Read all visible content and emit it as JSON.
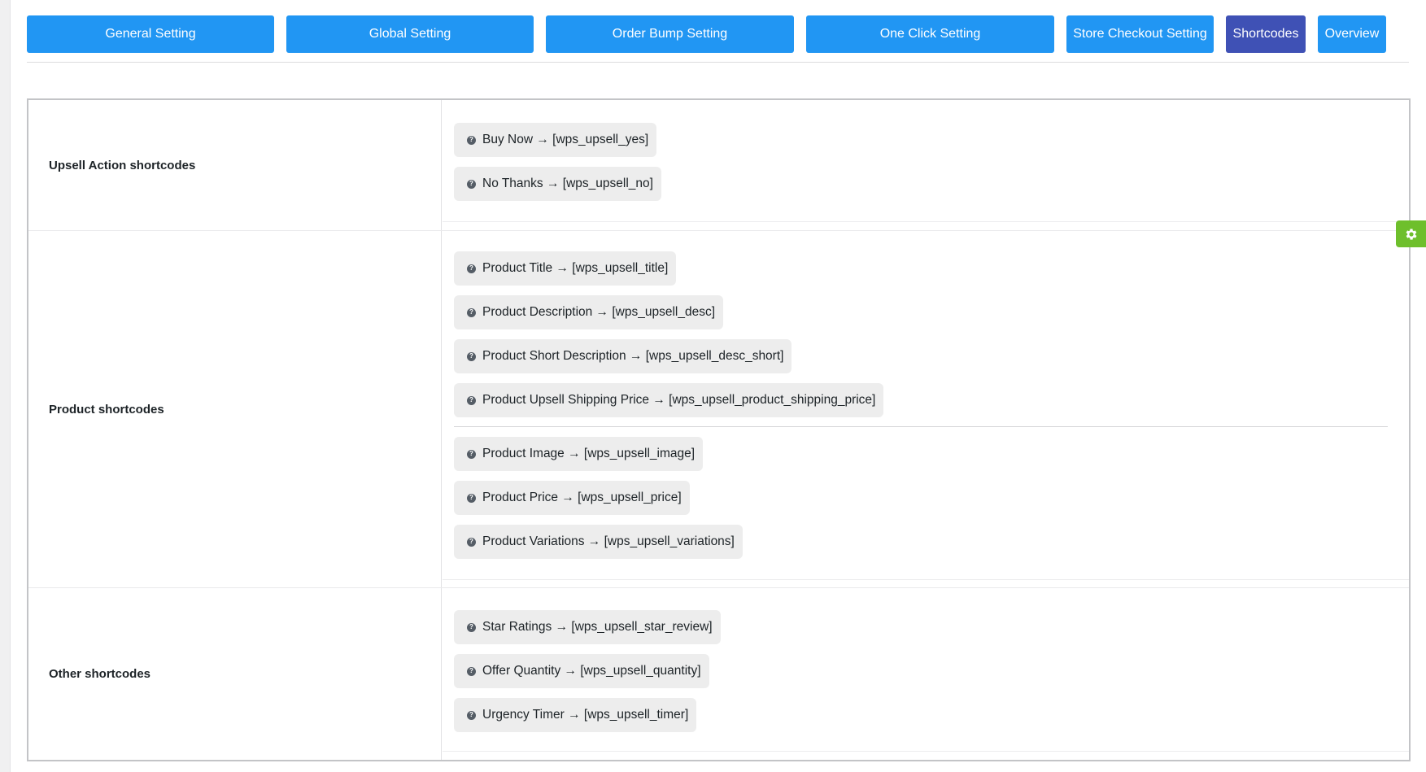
{
  "tabs": [
    {
      "label": "General Setting",
      "active": false
    },
    {
      "label": "Global Setting",
      "active": false
    },
    {
      "label": "Order Bump Setting",
      "active": false
    },
    {
      "label": "One Click Setting",
      "active": false
    },
    {
      "label": "Store Checkout Setting",
      "active": false
    },
    {
      "label": "Shortcodes",
      "active": true
    },
    {
      "label": "Overview",
      "active": false
    }
  ],
  "sections": [
    {
      "label": "Upsell Action shortcodes",
      "items": [
        "Buy Now → [wps_upsell_yes]",
        "No Thanks → [wps_upsell_no]"
      ]
    },
    {
      "label": "Product shortcodes",
      "items": [
        "Product Title → [wps_upsell_title]",
        "Product Description → [wps_upsell_desc]",
        "Product Short Description → [wps_upsell_desc_short]",
        "Product Upsell Shipping Price → [wps_upsell_product_shipping_price]",
        "Product Image → [wps_upsell_image]",
        "Product Price → [wps_upsell_price]",
        "Product Variations → [wps_upsell_variations]"
      ]
    },
    {
      "label": "Other shortcodes",
      "items": [
        "Star Ratings → [wps_upsell_star_review]",
        "Offer Quantity → [wps_upsell_quantity]",
        "Urgency Timer → [wps_upsell_timer]"
      ]
    }
  ],
  "icons": {
    "chip_icon": "question-circle-icon",
    "side_tab_icon": "gear-icon"
  },
  "colors": {
    "tab": "#2196f3",
    "tab_active": "#3f51b5",
    "chip_bg": "#ededed",
    "gear_tab": "#6ebf2c"
  }
}
